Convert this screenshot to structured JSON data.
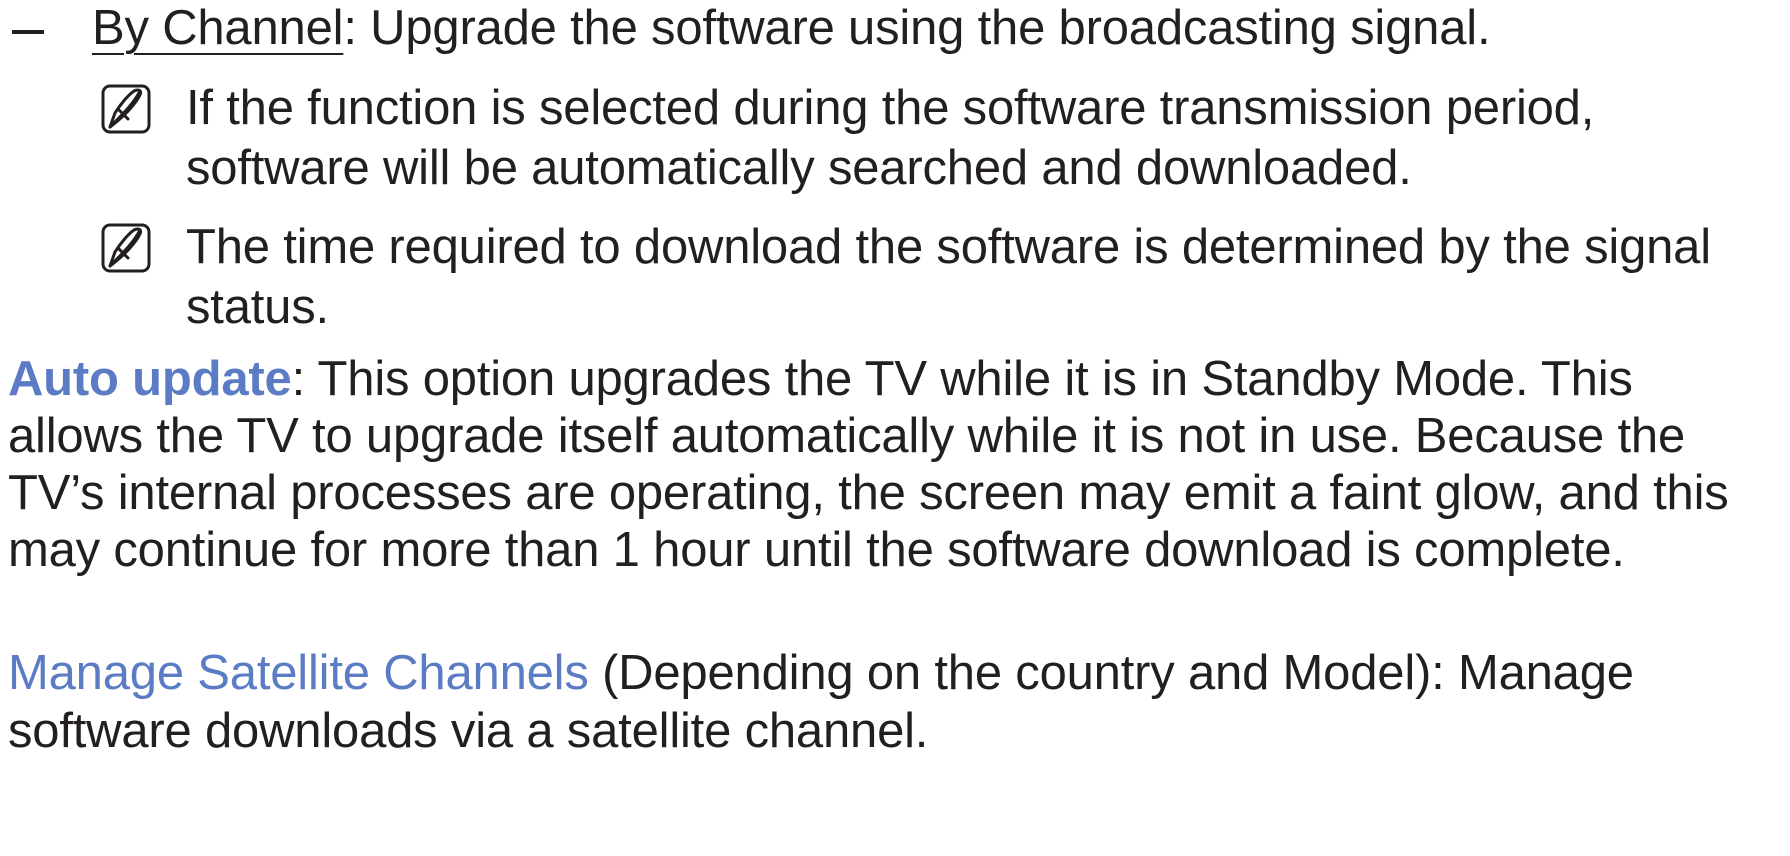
{
  "by_channel": {
    "title": "By Channel",
    "description": ": Upgrade the software using the broadcasting signal."
  },
  "notes": [
    {
      "icon": "note-icon",
      "text": "If the function is selected during the software transmission period, software will be automatically searched and downloaded."
    },
    {
      "icon": "note-icon",
      "text": "The time required to download the software is determined by the signal status."
    }
  ],
  "auto_update": {
    "term": "Auto update",
    "description": ": This option upgrades the TV while it is in Standby Mode. This allows the TV to upgrade itself automatically while it is not in use. Because the TV’s internal processes are operating, the screen may emit a faint glow, and this may continue for more than 1 hour until the software download is complete."
  },
  "manage_satellite": {
    "term": "Manage Satellite Channels",
    "description": " (Depending on the country and Model): Manage software downloads via a satellite channel."
  },
  "colors": {
    "text": "#231f20",
    "term_accent": "#5b7cc4"
  }
}
